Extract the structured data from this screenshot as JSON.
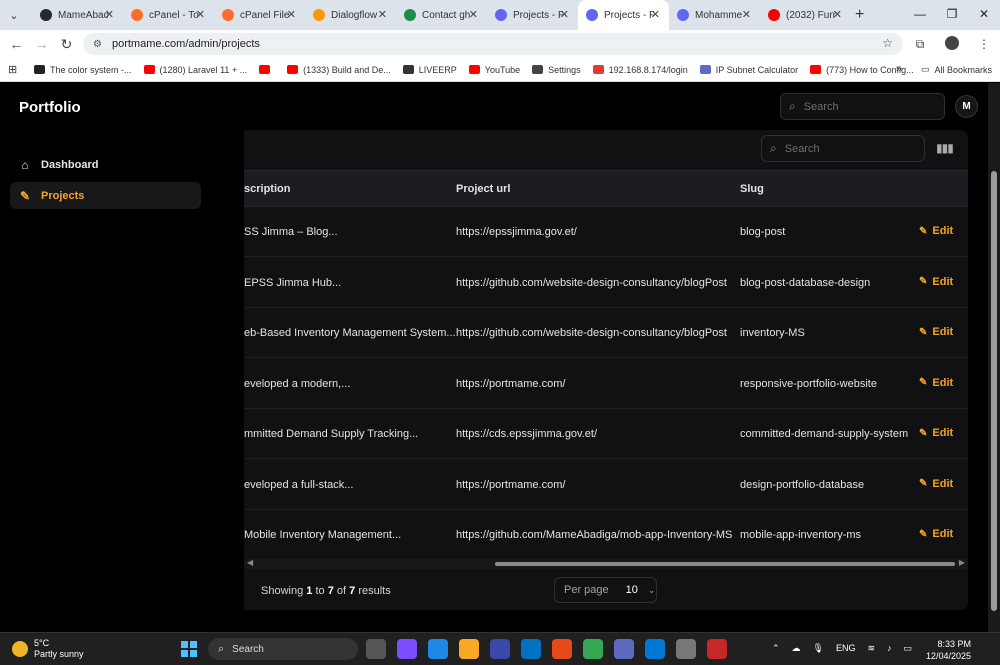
{
  "browser": {
    "tabs": [
      {
        "title": "MameAbadi",
        "color": "#24292f"
      },
      {
        "title": "cPanel - To",
        "color": "#ff6c2c"
      },
      {
        "title": "cPanel File",
        "color": "#ff6c2c"
      },
      {
        "title": "Dialogflow",
        "color": "#ff9800"
      },
      {
        "title": "Contact gh",
        "color": "#1f8a4c"
      },
      {
        "title": "Projects - F",
        "color": "#6366f1"
      },
      {
        "title": "Projects - F",
        "color": "#6366f1",
        "active": true
      },
      {
        "title": "Mohamme",
        "color": "#6366f1"
      },
      {
        "title": "(2032) Furn",
        "color": "#ff0000"
      }
    ],
    "url": "portmame.com/admin/projects",
    "bookmarks": [
      {
        "label": "The color system -...",
        "color": "#222"
      },
      {
        "label": "(1280) Laravel 11 + ...",
        "color": "#ff0000"
      },
      {
        "label": "",
        "color": "#ff0000"
      },
      {
        "label": "(1333) Build and De...",
        "color": "#ff0000"
      },
      {
        "label": "LIVEERP",
        "color": "#333"
      },
      {
        "label": "YouTube",
        "color": "#ff0000"
      },
      {
        "label": "Settings",
        "color": "#444"
      },
      {
        "label": "192.168.8.174/login",
        "color": "#e53935"
      },
      {
        "label": "IP Subnet Calculator",
        "color": "#5c6bc0"
      },
      {
        "label": "(773) How to Config...",
        "color": "#ff0000"
      }
    ],
    "all_bookmarks": "All Bookmarks"
  },
  "app": {
    "brand": "Portfolio",
    "search_placeholder": "Search",
    "avatar": "M",
    "sidebar": [
      {
        "label": "Dashboard",
        "icon": "home-icon"
      },
      {
        "label": "Projects",
        "icon": "tools-icon",
        "active": true
      }
    ],
    "table": {
      "search_placeholder": "Search",
      "columns": [
        "scription",
        "Project url",
        "Slug"
      ],
      "edit_label": "Edit",
      "rows": [
        {
          "desc": "SS Jimma – Blog...",
          "url": "https://epssjimma.gov.et/",
          "slug": "blog-post"
        },
        {
          "desc": "EPSS Jimma Hub...",
          "url": "https://github.com/website-design-consultancy/blogPost",
          "slug": "blog-post-database-design"
        },
        {
          "desc": "eb-Based Inventory Management System...",
          "url": "https://github.com/website-design-consultancy/blogPost",
          "slug": "inventory-MS"
        },
        {
          "desc": "eveloped a modern,...",
          "url": "https://portmame.com/",
          "slug": "responsive-portfolio-website"
        },
        {
          "desc": "mmitted Demand Supply Tracking...",
          "url": "https://cds.epssjimma.gov.et/",
          "slug": "committed-demand-supply-system"
        },
        {
          "desc": "eveloped a full-stack...",
          "url": "https://portmame.com/",
          "slug": "design-portfolio-database"
        },
        {
          "desc": "Mobile Inventory Management...",
          "url": "https://github.com/MameAbadiga/mob-app-Inventory-MS",
          "slug": "mobile-app-inventory-ms"
        }
      ]
    },
    "pagination": {
      "showing": "Showing",
      "from": "1",
      "to_word": "to",
      "to": "7",
      "of_word": "of",
      "total": "7",
      "results": "results",
      "per_page_label": "Per page",
      "per_page_value": "10"
    }
  },
  "taskbar": {
    "temp": "5°C",
    "weather": "Partly sunny",
    "search": "Search",
    "lang": "ENG",
    "time": "8:33 PM",
    "date": "12/04/2025"
  }
}
